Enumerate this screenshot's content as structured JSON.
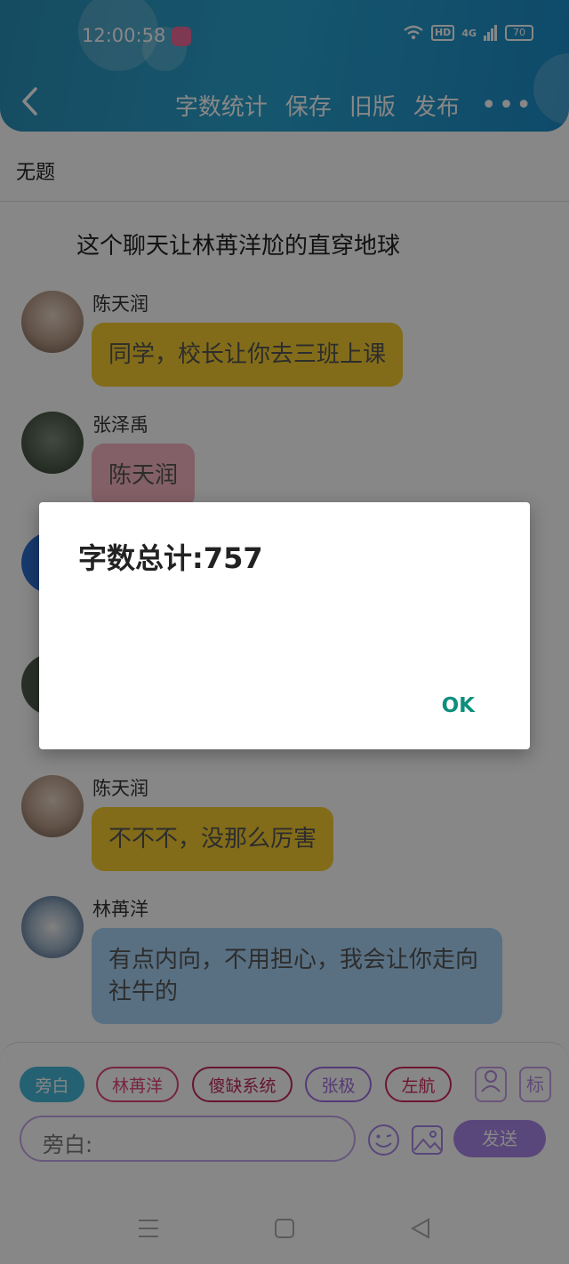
{
  "status": {
    "time": "12:00:58",
    "network": "4G",
    "hd": "HD",
    "battery": "70"
  },
  "toolbar": {
    "word_count": "字数统计",
    "save": "保存",
    "old_version": "旧版",
    "publish": "发布",
    "more": "•••"
  },
  "doc_title": "无题",
  "story_title": "这个聊天让林苒洋尬的直穿地球",
  "messages": [
    {
      "name": "陈天润",
      "text": "同学，校长让你去三班上课",
      "color": "#f5cd30"
    },
    {
      "name": "张泽禹",
      "text": "陈天润",
      "color": "#f7b6c2"
    },
    {
      "name": "陈天润",
      "text": "不不不，没那么厉害",
      "color": "#f5cd30"
    },
    {
      "name": "林苒洋",
      "text": "有点内向，不用担心，我会让你走向社牛的",
      "color": "#a9d4f5"
    }
  ],
  "dialog": {
    "title": "字数总计:757",
    "ok": "OK"
  },
  "roles": [
    {
      "label": "旁白",
      "selected": true
    },
    {
      "label": "林苒洋",
      "selected": false
    },
    {
      "label": "傻缺系统",
      "selected": false
    },
    {
      "label": "张极",
      "selected": false
    },
    {
      "label": "左航",
      "selected": false
    }
  ],
  "side_icons": {
    "mark": "标"
  },
  "input": {
    "placeholder": "旁白:"
  },
  "send_label": "发送",
  "colors": {
    "header": "#2aa3cf",
    "accent": "#a885e6",
    "ok": "#0f8f7e"
  }
}
